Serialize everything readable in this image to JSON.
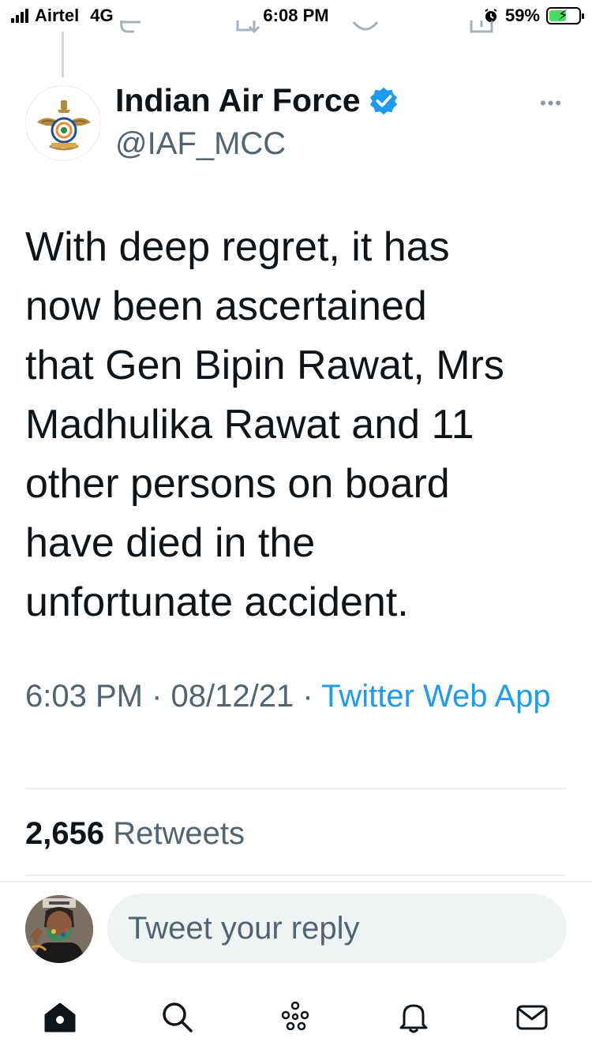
{
  "status_bar": {
    "carrier": "Airtel",
    "network": "4G",
    "time": "6:08 PM",
    "battery_percent": "59%",
    "battery_level": 0.59
  },
  "tweet": {
    "display_name": "Indian Air Force",
    "handle": "@IAF_MCC",
    "verified": true,
    "text": "With deep regret, it has\nnow been ascertained\nthat Gen Bipin Rawat, Mrs\nMadhulika Rawat and 11\nother persons on board\nhave died in the\nunfortunate accident.",
    "time": "6:03 PM",
    "date": "08/12/21",
    "separator": "·",
    "source": "Twitter Web App",
    "retweet_count": "2,656",
    "retweet_label": "Retweets"
  },
  "reply": {
    "placeholder": "Tweet your reply"
  },
  "tab_bar": {
    "items": [
      "home-icon",
      "search-icon",
      "spaces-icon",
      "notifications-icon",
      "messages-icon"
    ]
  },
  "colors": {
    "accent": "#1d9bf0",
    "text": "#0f1419",
    "secondary": "#536471"
  }
}
